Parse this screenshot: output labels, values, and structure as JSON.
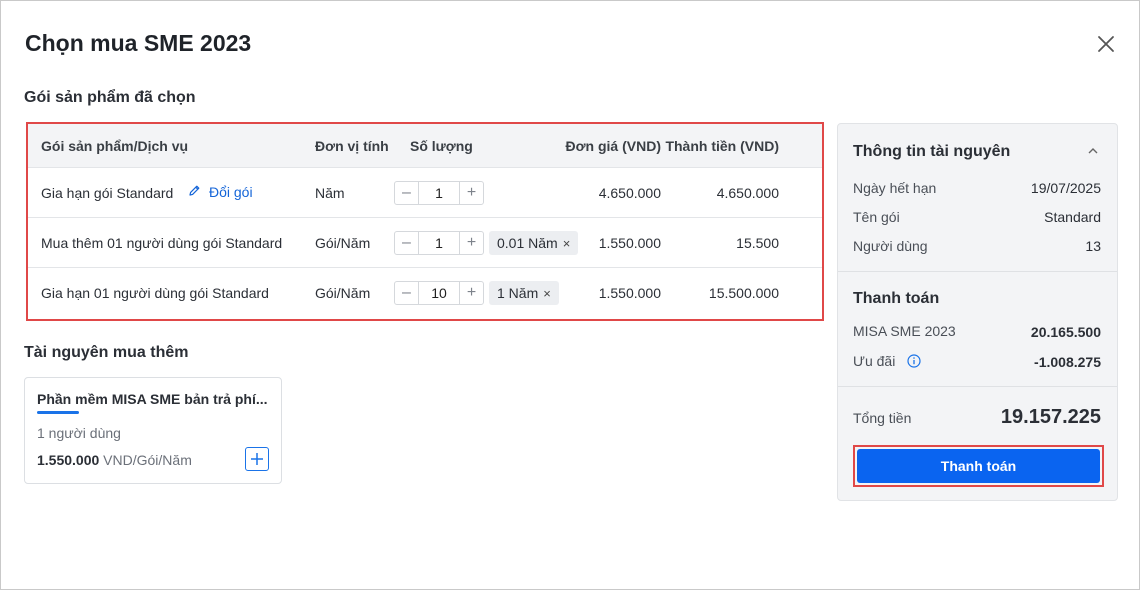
{
  "dialog": {
    "title": "Chọn mua SME 2023"
  },
  "selected": {
    "section_title": "Gói sản phẩm đã chọn",
    "headers": {
      "product": "Gói sản phẩm/Dịch vụ",
      "unit": "Đơn vị tính",
      "quantity": "Số lượng",
      "unit_price": "Đơn giá (VND)",
      "amount": "Thành tiền (VND)"
    },
    "rows": [
      {
        "product": "Gia hạn gói Standard",
        "edit_label": "Đổi gói",
        "unit": "Năm",
        "quantity": "1",
        "tag": "",
        "unit_price": "4.650.000",
        "amount": "4.650.000"
      },
      {
        "product": "Mua thêm 01 người dùng gói Standard",
        "edit_label": "",
        "unit": "Gói/Năm",
        "quantity": "1",
        "tag": "0.01 Năm",
        "unit_price": "1.550.000",
        "amount": "15.500"
      },
      {
        "product": "Gia hạn 01 người dùng gói Standard",
        "edit_label": "",
        "unit": "Gói/Năm",
        "quantity": "10",
        "tag": "1 Năm",
        "unit_price": "1.550.000",
        "amount": "15.500.000"
      }
    ],
    "tag_close": "×"
  },
  "extra": {
    "section_title": "Tài nguyên mua thêm",
    "card": {
      "title": "Phần mềm MISA SME bản trả phí...",
      "users": "1 người dùng",
      "price": "1.550.000",
      "price_unit": " VND/Gói/Năm"
    }
  },
  "resource_info": {
    "title": "Thông tin tài nguyên",
    "expiry_label": "Ngày hết hạn",
    "expiry_value": "19/07/2025",
    "package_label": "Tên gói",
    "package_value": "Standard",
    "users_label": "Người dùng",
    "users_value": "13"
  },
  "payment": {
    "title": "Thanh toán",
    "item_label": "MISA SME 2023",
    "item_value": "20.165.500",
    "discount_label": "Ưu đãi",
    "discount_value": "-1.008.275",
    "total_label": "Tổng tiền",
    "total_value": "19.157.225",
    "pay_button": "Thanh toán"
  },
  "colors": {
    "accent": "#0a64f0",
    "highlight": "#e04848",
    "link": "#1565d8"
  },
  "icons": {
    "close": "close-icon",
    "edit": "pencil-icon",
    "collapse": "chevron-up-icon",
    "info": "info-icon",
    "add": "plus-icon"
  }
}
